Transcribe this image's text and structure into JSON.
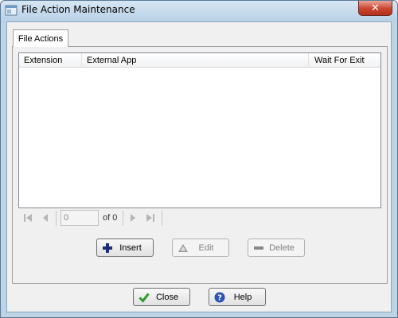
{
  "window": {
    "title": "File Action Maintenance",
    "close_glyph": "✕"
  },
  "tabs": [
    {
      "label": "File Actions"
    }
  ],
  "grid": {
    "columns": [
      "Extension",
      "External App",
      "Wait For Exit"
    ],
    "rows": []
  },
  "navigator": {
    "page_value": "0",
    "page_of": "of 0"
  },
  "actions": {
    "insert": "Insert",
    "edit": "Edit",
    "delete": "Delete"
  },
  "footer": {
    "close": "Close",
    "help": "Help"
  },
  "colors": {
    "accent_insert": "#1b2a7a",
    "check": "#2a9a2a",
    "help": "#2b55b0"
  },
  "icons": {
    "title": "window-app-icon",
    "nav": [
      "first-page-icon",
      "prev-page-icon",
      "next-page-icon",
      "last-page-icon"
    ],
    "insert": "plus-icon",
    "edit": "triangle-icon",
    "delete": "minus-icon",
    "close": "checkmark-icon",
    "help": "question-icon"
  }
}
